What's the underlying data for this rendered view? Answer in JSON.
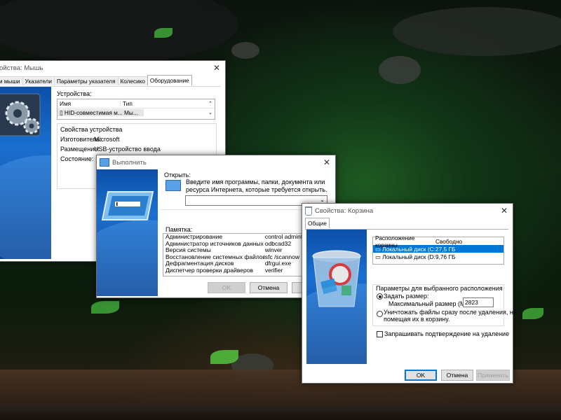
{
  "mouse_window": {
    "title": "ойства: Мышь",
    "tabs": [
      "и мыши",
      "Указатели",
      "Параметры указателя",
      "Колесико",
      "Оборудование"
    ],
    "devices_label": "Устройства:",
    "columns": [
      "Имя",
      "Тип"
    ],
    "device_row": {
      "name": "HID-совместимая м...",
      "type": "Мы..."
    },
    "props_title": "Свойства устройства",
    "manufacturer_label": "Изготовитель:",
    "manufacturer": "Microsoft",
    "location_label": "Размещение:",
    "location": "USB-устройство ввода",
    "status_label": "Состояние:"
  },
  "run_window": {
    "title": "Выполнить",
    "open_label": "Открыть:",
    "description": "Введите имя программы, папки, документа или ресурса Интернета, которые требуется открыть.",
    "input_value": "",
    "memo_label": "Памятка:",
    "memo_rows": [
      [
        "Администрирование",
        "control adminto"
      ],
      [
        "Администратор источников данных",
        "odbcad32"
      ],
      [
        "Версия системы",
        "winver"
      ],
      [
        "Восстановление системных файлов",
        "sfc /scannow"
      ],
      [
        "Дефрагментация дисков",
        "dfrgui.exe"
      ],
      [
        "Диспетчер проверки драйверов",
        "verifier"
      ]
    ],
    "ok": "OK",
    "cancel": "Отмена"
  },
  "bin_window": {
    "title": "Свойства: Корзина",
    "tab": "Общие",
    "columns": [
      "Расположение корзины",
      "Свободно"
    ],
    "drives": [
      {
        "name": "Локальный диск (C:)",
        "free": "27,5 ГБ"
      },
      {
        "name": "Локальный диск (D:)",
        "free": "9,76 ГБ"
      }
    ],
    "params_title": "Параметры для выбранного расположения",
    "custom_size": "Задать размер:",
    "max_size_label": "Максимальный размер (МБ):",
    "max_size_value": "2823",
    "delete_now_line1": "Уничтожать файлы сразу после удаления, не",
    "delete_now_line2": "помещая их в корзину.",
    "confirm_delete": "Запрашивать подтверждение на удаление",
    "ok": "OK",
    "cancel": "Отмена",
    "apply": "Применить"
  },
  "colors": {
    "accent": "#0078d7",
    "window_blue": "#1b6fd0"
  }
}
